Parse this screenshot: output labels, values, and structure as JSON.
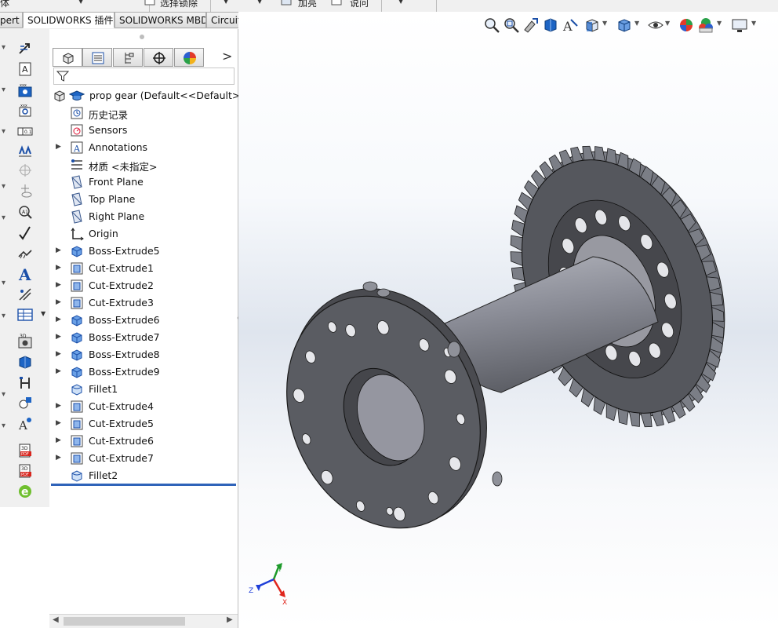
{
  "top_toolbar": {
    "left_text": "体",
    "item_a": "选择锁除",
    "item_b": "加亮",
    "item_c": "说问"
  },
  "tabs": [
    {
      "label": "pert",
      "active": false
    },
    {
      "label": "SOLIDWORKS 插件",
      "active": true
    },
    {
      "label": "SOLIDWORKS MBD",
      "active": false
    },
    {
      "label": "CircuitWorks",
      "active": false
    }
  ],
  "feature_manager": {
    "panel_tabs": [
      "feature-manager-tree",
      "property-manager",
      "configuration-manager",
      "dimxpert-manager",
      "display-manager"
    ],
    "expand_label": ">",
    "filter_placeholder": "",
    "root": "prop gear  (Default<<Default>_",
    "items": [
      {
        "label": "历史记录",
        "icon": "history-icon",
        "expandable": false
      },
      {
        "label": "Sensors",
        "icon": "sensor-icon",
        "expandable": false
      },
      {
        "label": "Annotations",
        "icon": "annotation-icon",
        "expandable": true
      },
      {
        "label": "材质 <未指定>",
        "icon": "material-icon",
        "expandable": false
      },
      {
        "label": "Front Plane",
        "icon": "plane-icon",
        "expandable": false
      },
      {
        "label": "Top Plane",
        "icon": "plane-icon",
        "expandable": false
      },
      {
        "label": "Right Plane",
        "icon": "plane-icon",
        "expandable": false
      },
      {
        "label": "Origin",
        "icon": "origin-icon",
        "expandable": false
      },
      {
        "label": "Boss-Extrude5",
        "icon": "boss-extrude-icon",
        "expandable": true
      },
      {
        "label": "Cut-Extrude1",
        "icon": "cut-extrude-icon",
        "expandable": true
      },
      {
        "label": "Cut-Extrude2",
        "icon": "cut-extrude-icon",
        "expandable": true
      },
      {
        "label": "Cut-Extrude3",
        "icon": "cut-extrude-icon",
        "expandable": true
      },
      {
        "label": "Boss-Extrude6",
        "icon": "boss-extrude-icon",
        "expandable": true
      },
      {
        "label": "Boss-Extrude7",
        "icon": "boss-extrude-icon",
        "expandable": true
      },
      {
        "label": "Boss-Extrude8",
        "icon": "boss-extrude-icon",
        "expandable": true
      },
      {
        "label": "Boss-Extrude9",
        "icon": "boss-extrude-icon",
        "expandable": true
      },
      {
        "label": "Fillet1",
        "icon": "fillet-icon",
        "expandable": false
      },
      {
        "label": "Cut-Extrude4",
        "icon": "cut-extrude-icon",
        "expandable": true
      },
      {
        "label": "Cut-Extrude5",
        "icon": "cut-extrude-icon",
        "expandable": true
      },
      {
        "label": "Cut-Extrude6",
        "icon": "cut-extrude-icon",
        "expandable": true
      },
      {
        "label": "Cut-Extrude7",
        "icon": "cut-extrude-icon",
        "expandable": true
      },
      {
        "label": "Fillet2",
        "icon": "fillet-icon",
        "expandable": false
      }
    ]
  },
  "left_toolbar": {
    "tools": [
      "smart-dimension-icon",
      "text-note-icon",
      "balloon-icon",
      "auto-balloon-icon",
      "geometric-tolerance-icon",
      "datum-feature-icon",
      "datum-target-icon",
      "center-mark-icon",
      "surface-finish-icon",
      "weld-symbol-icon",
      "text-icon",
      "hole-callout-icon",
      "table-icon",
      "3d-view-icon",
      "publish-icon",
      "hole-table-icon",
      "symbol-icon",
      "annotation-view-icon",
      "3d-pdf-icon",
      "3d-pdf-template-icon",
      "edrawings-icon"
    ]
  },
  "heads_up_toolbar": {
    "tools": [
      "zoom-to-fit-icon",
      "zoom-to-area-icon",
      "previous-view-icon",
      "section-view-icon",
      "dynamic-annotation-icon",
      "view-orientation-icon",
      "display-style-icon",
      "hide-show-icon",
      "edit-appearance-icon",
      "scene-icon",
      "view-settings-icon"
    ]
  },
  "viewport": {
    "model_name": "prop gear",
    "triad": {
      "x": "X",
      "y": "Y",
      "z": "Z"
    }
  },
  "colors": {
    "tab_active_bg": "#ffffff",
    "rollback_bar": "#2f63b9",
    "model_face": "#5a5c62",
    "model_shaft": "#9496a0",
    "triad_x": "#e0261c",
    "triad_y": "#1d9a2a",
    "triad_z": "#1f3fd8"
  }
}
